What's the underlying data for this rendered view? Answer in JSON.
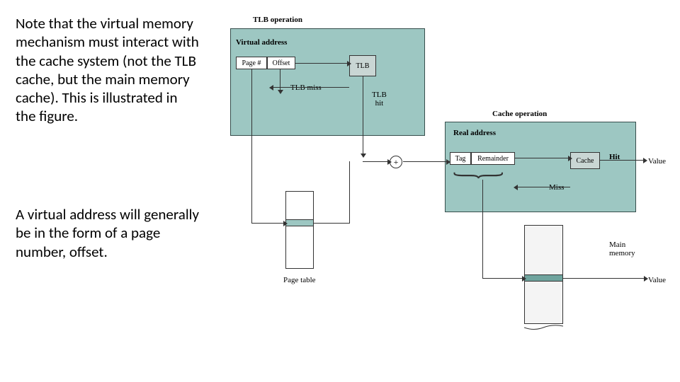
{
  "paragraphs": {
    "p1": "Note that the virtual memory mechanism must interact with the cache system (not the TLB cache, but the main memory cache). This is illustrated in the figure.",
    "p2": "A virtual address will generally be in the form of a page number, offset."
  },
  "diagram": {
    "tlb_operation": "TLB operation",
    "virtual_address": "Virtual address",
    "page_num": "Page #",
    "offset": "Offset",
    "tlb": "TLB",
    "tlb_miss": "TLB miss",
    "tlb_hit": "TLB\nhit",
    "cache_operation": "Cache operation",
    "real_address": "Real address",
    "tag": "Tag",
    "remainder": "Remainder",
    "cache": "Cache",
    "hit": "Hit",
    "miss": "Miss",
    "page_table": "Page table",
    "main_memory": "Main\nmemory",
    "value1": "Value",
    "value2": "Value",
    "plus": "+"
  }
}
